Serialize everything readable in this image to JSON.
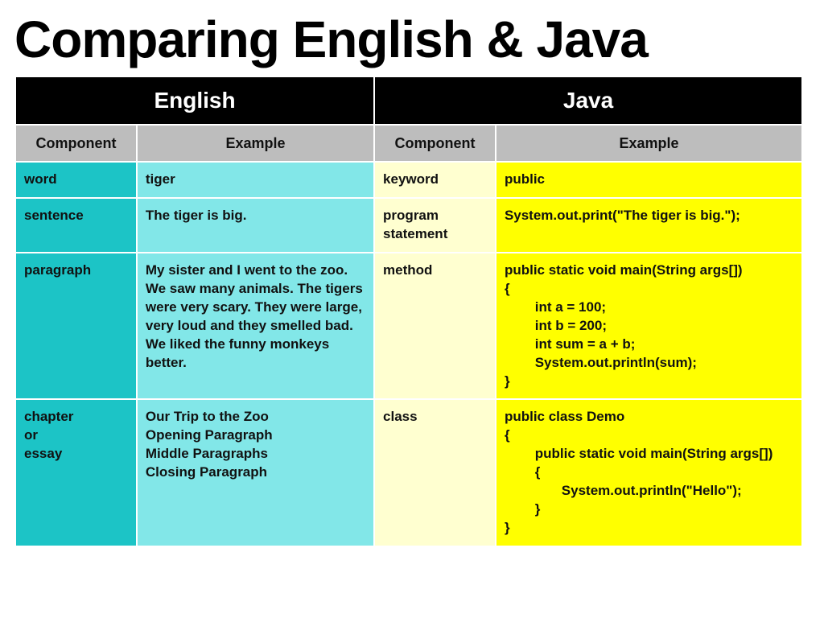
{
  "title": "Comparing English & Java",
  "header": {
    "english": "English",
    "java": "Java",
    "component": "Component",
    "example": "Example"
  },
  "rows": [
    {
      "eng_component": "word",
      "eng_example": "tiger",
      "java_component": "keyword",
      "java_example": "public"
    },
    {
      "eng_component": "sentence",
      "eng_example": "The tiger is big.",
      "java_component": "program\nstatement",
      "java_example": "System.out.print(\"The tiger is big.\");"
    },
    {
      "eng_component": "paragraph",
      "eng_example": "My sister and I went to the zoo.  We saw many animals. The tigers were very scary. They were large, very loud and they smelled bad.  We liked the funny monkeys better.",
      "java_component": "method",
      "java_example": "public static void main(String args[])\n{\n        int a = 100;\n        int b = 200;\n        int sum = a + b;\n        System.out.println(sum);\n}"
    },
    {
      "eng_component": "chapter\nor\nessay",
      "eng_example": "Our Trip to the Zoo\nOpening Paragraph\nMiddle Paragraphs\nClosing Paragraph",
      "java_component": "class",
      "java_example": "public class Demo\n{\n        public static void main(String args[])\n        {\n               System.out.println(\"Hello\");\n        }\n}"
    }
  ]
}
